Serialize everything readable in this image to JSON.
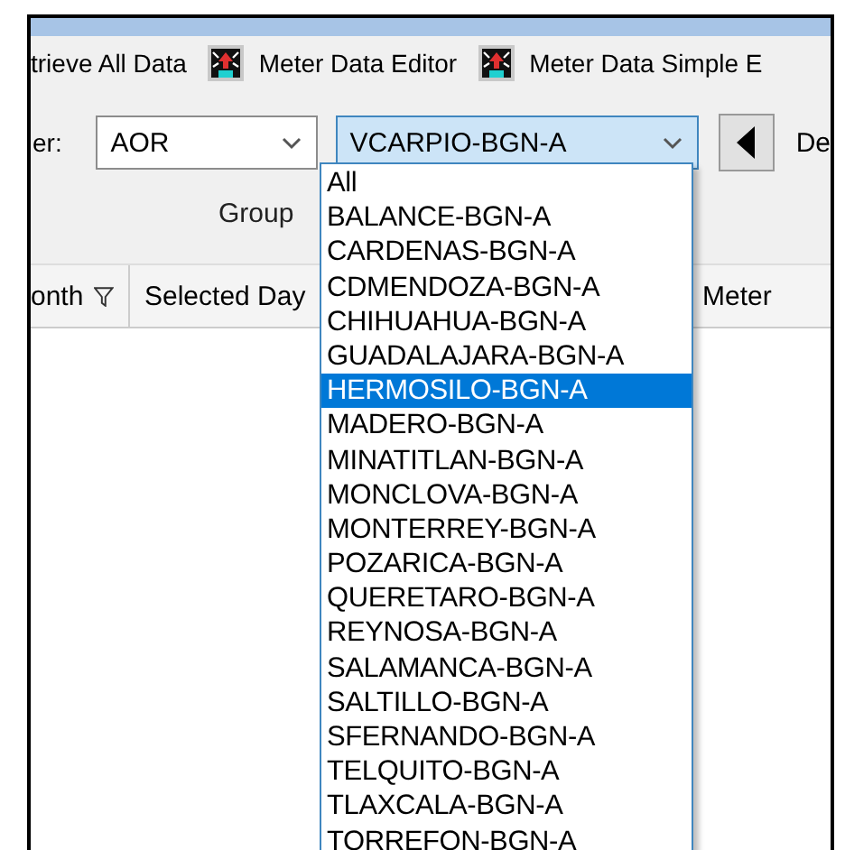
{
  "toolbar": [
    {
      "label": "trieve All Data",
      "icon": false
    },
    {
      "label": "Meter Data Editor",
      "icon": true
    },
    {
      "label": "Meter Data Simple E",
      "icon": true
    }
  ],
  "filter": {
    "label": "er:",
    "combos": [
      {
        "value": "AOR",
        "open": false
      },
      {
        "value": "VCARPIO-BGN-A",
        "open": true
      }
    ],
    "next_label": "De"
  },
  "group_label": "Group",
  "grid": {
    "columns": [
      {
        "label": "onth",
        "filter": true
      },
      {
        "label": "Selected Day",
        "filter": false
      },
      {
        "label": "Meter",
        "filter": false
      }
    ]
  },
  "dropdown": {
    "items": [
      {
        "label": "All",
        "selected": false
      },
      {
        "label": "BALANCE-BGN-A",
        "selected": false
      },
      {
        "label": "CARDENAS-BGN-A",
        "selected": false
      },
      {
        "label": "CDMENDOZA-BGN-A",
        "selected": false
      },
      {
        "label": "CHIHUAHUA-BGN-A",
        "selected": false
      },
      {
        "label": "GUADALAJARA-BGN-A",
        "selected": false
      },
      {
        "label": "HERMOSILO-BGN-A",
        "selected": true
      },
      {
        "label": "MADERO-BGN-A",
        "selected": false
      },
      {
        "label": "MINATITLAN-BGN-A",
        "selected": false
      },
      {
        "label": "MONCLOVA-BGN-A",
        "selected": false
      },
      {
        "label": "MONTERREY-BGN-A",
        "selected": false
      },
      {
        "label": "POZARICA-BGN-A",
        "selected": false
      },
      {
        "label": "QUERETARO-BGN-A",
        "selected": false
      },
      {
        "label": "REYNOSA-BGN-A",
        "selected": false
      },
      {
        "label": "SALAMANCA-BGN-A",
        "selected": false
      },
      {
        "label": "SALTILLO-BGN-A",
        "selected": false
      },
      {
        "label": "SFERNANDO-BGN-A",
        "selected": false
      },
      {
        "label": "TELQUITO-BGN-A",
        "selected": false
      },
      {
        "label": "TLAXCALA-BGN-A",
        "selected": false
      },
      {
        "label": "TORREFON-BGN-A",
        "selected": false
      }
    ]
  }
}
